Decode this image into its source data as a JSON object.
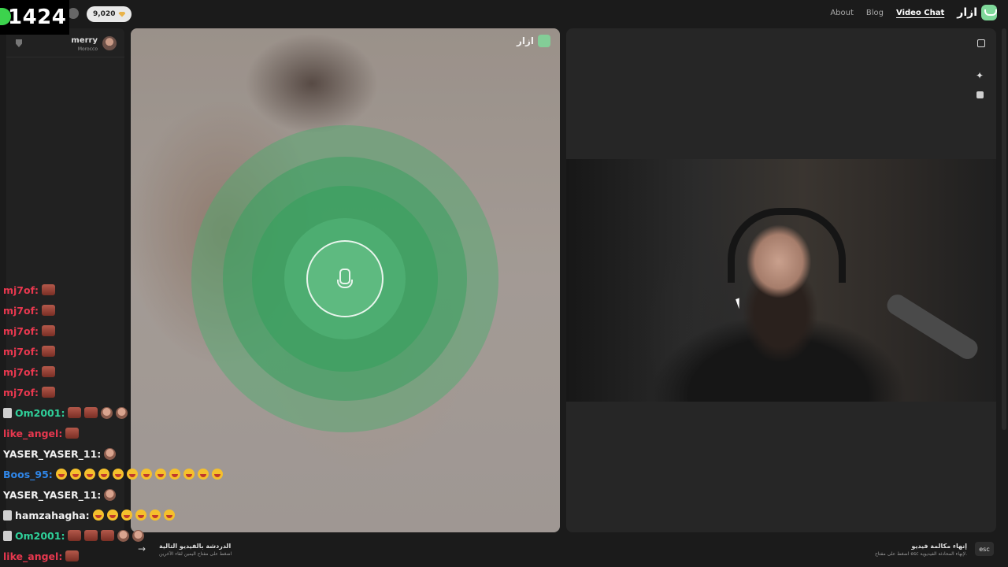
{
  "stream": {
    "viewer_count": "1424"
  },
  "header": {
    "coins": "9,020",
    "nav": {
      "about": "About",
      "blog": "Blog",
      "video_chat": "Video Chat"
    },
    "logo_text": "ازار"
  },
  "peer": {
    "name": "merry",
    "country": "Morocco"
  },
  "watermark": "ازار",
  "chat": [
    {
      "user": "mj7of:",
      "color": "red",
      "items": [
        "emote"
      ]
    },
    {
      "user": "mj7of:",
      "color": "red",
      "items": [
        "emote"
      ]
    },
    {
      "user": "mj7of:",
      "color": "red",
      "items": [
        "emote"
      ]
    },
    {
      "user": "mj7of:",
      "color": "red",
      "items": [
        "emote"
      ]
    },
    {
      "user": "mj7of:",
      "color": "red",
      "items": [
        "emote"
      ]
    },
    {
      "user": "mj7of:",
      "color": "red",
      "items": [
        "emote"
      ]
    },
    {
      "user": "Om2001:",
      "color": "green",
      "badge": true,
      "items": [
        "emote",
        "emote",
        "round",
        "round"
      ]
    },
    {
      "user": "like_angel:",
      "color": "red",
      "items": [
        "emote"
      ]
    },
    {
      "user": "YASER_YASER_11:",
      "color": "white",
      "items": [
        "round"
      ]
    },
    {
      "user": "Boos_95:",
      "color": "blue",
      "items": [
        "laugh",
        "laugh",
        "laugh",
        "laugh",
        "laugh",
        "laugh",
        "laugh",
        "laugh",
        "laugh",
        "laugh",
        "laugh",
        "laugh"
      ]
    },
    {
      "user": "YASER_YASER_11:",
      "color": "white",
      "items": [
        "round"
      ]
    },
    {
      "user": "hamzahagha:",
      "color": "white",
      "badge": true,
      "items": [
        "laugh",
        "laugh",
        "laugh",
        "laugh",
        "laugh",
        "laugh"
      ]
    },
    {
      "user": "Om2001:",
      "color": "green",
      "badge": true,
      "items": [
        "emote",
        "emote",
        "emote",
        "round",
        "round"
      ]
    },
    {
      "user": "like_angel:",
      "color": "red",
      "items": [
        "emote"
      ]
    }
  ],
  "footer": {
    "next_title": "الدردشة بالفيديو التالية",
    "next_sub": "اضغط على مفتاح اليمين لقاء الآخرين",
    "end_title": "إنهاء مكالمة فيديو",
    "end_sub": "اضغط على مفتاح esc لإنهاء المحادثة الفيديوية.",
    "esc_key": "esc"
  },
  "colors": {
    "accent_green": "#3cd34d",
    "mic_green": "#3aa060",
    "chat_red": "#e8384f",
    "chat_green": "#2fd09a",
    "chat_blue": "#2f86e8"
  }
}
